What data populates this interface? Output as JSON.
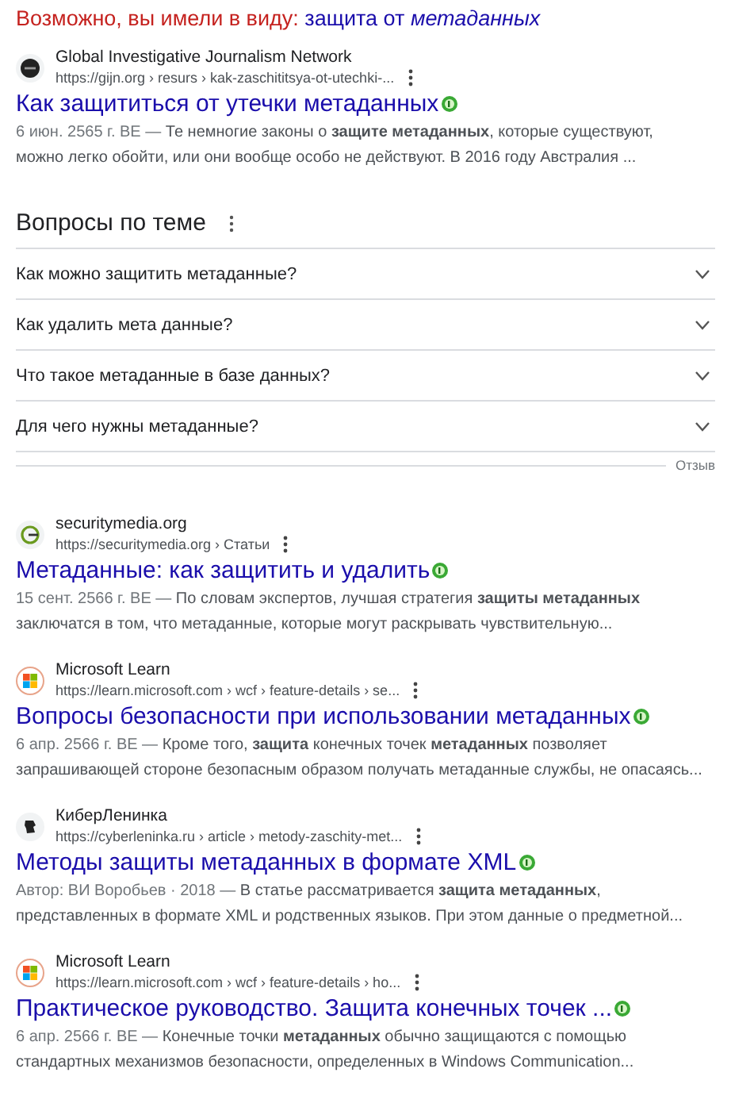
{
  "suggestion": {
    "label": "Возможно, вы имели в виду:",
    "query": "защита от *метаданных*"
  },
  "results_top": [
    {
      "kind": "gijn",
      "site": "Global Investigative Journalism Network",
      "url": "https://gijn.org › resurs › kak-zaschititsya-ot-utechki-...",
      "title": "Как защититься от утечки метаданных",
      "date": "6 июн. 2565 г. BE —",
      "lines": [
        "Те немногие законы о **защите метаданных**, которые существуют,",
        "можно легко обойти, или они вообще особо не действуют. В 2016 году Австралия ..."
      ]
    }
  ],
  "related_questions": {
    "title": "Вопросы по теме",
    "items": [
      {
        "text": "Как можно защитить метаданные?",
        "expanded": false
      },
      {
        "text": "Как удалить мета данные?",
        "expanded": false
      },
      {
        "text": "Что такое метаданные в базе данных?",
        "expanded": false
      },
      {
        "text": "Для чего нужны метаданные?",
        "expanded": false
      }
    ],
    "feedback": "Отзыв"
  },
  "results": [
    {
      "kind": "securitymedia",
      "site": "securitymedia.org",
      "url": "https://securitymedia.org › Статьи",
      "title": "Метаданные: как защитить и удалить",
      "date": "15 сент. 2566 г. BE —",
      "lines": [
        "По словам экспертов, лучшая стратегия **защиты метаданных**",
        "заключатся в том, что метаданные, которые могут раскрывать чувствительную..."
      ]
    },
    {
      "kind": "microsoft",
      "site": "Microsoft Learn",
      "url": "https://learn.microsoft.com › wcf › feature-details › se...",
      "title": "Вопросы безопасности при использовании метаданных",
      "date": "6 апр. 2566 г. BE —",
      "lines": [
        "Кроме того, **защита** конечных точек **метаданных** позволяет",
        "запрашивающей стороне безопасным образом получать метаданные службы, не опасаясь..."
      ]
    },
    {
      "kind": "cyberleninka",
      "site": "КиберЛенинка",
      "url": "https://cyberleninka.ru › article › metody-zaschity-met...",
      "title": "Методы защиты метаданных в формате XML",
      "date": "Автор: ВИ Воробьев · 2018 —",
      "lines": [
        "В статье рассматривается **защита метаданных**,",
        "представленных в формате XML и родственных языков. При этом данные о предметной..."
      ]
    },
    {
      "kind": "microsoft",
      "site": "Microsoft Learn",
      "url": "https://learn.microsoft.com › wcf › feature-details › ho...",
      "title": "Практическое руководство. Защита конечных точек ...",
      "date": "6 апр. 2566 г. BE —",
      "lines": [
        "Конечные точки **метаданных** обычно защищаются с помощью",
        "стандартных механизмов безопасности, определенных в Windows Communication..."
      ]
    }
  ]
}
